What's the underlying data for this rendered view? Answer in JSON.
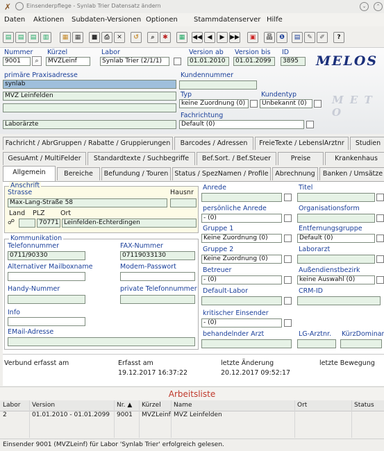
{
  "window": {
    "title": "Einsenderpflege - Synlab Trier Datensatz ändern"
  },
  "menu": [
    "Daten",
    "Aktionen",
    "Subdaten-Versionen",
    "Optionen",
    "Stammdatenserver",
    "Hilfe"
  ],
  "header": {
    "nummer_label": "Nummer",
    "nummer": "9001",
    "kuerzel_label": "Kürzel",
    "kuerzel": "MVZLeinf",
    "labor_label": "Labor",
    "labor": "Synlab Trier (2/1/1)",
    "version_ab_label": "Version ab",
    "version_ab": "01.01.2010",
    "version_bis_label": "Version bis",
    "version_bis": "01.01.2099",
    "id_label": "ID",
    "id": "3895",
    "logo": "MELOS",
    "praxis_label": "primäre Praxisadresse",
    "praxis1": "synlab",
    "praxis2": "MVZ Leinfelden",
    "praxis3": "",
    "praxis4": "Laborärzte",
    "kundennummer_label": "Kundennummer",
    "kundennummer": "",
    "typ_label": "Typ",
    "typ": "keine Zuordnung (0)",
    "kundentyp_label": "Kundentyp",
    "kundentyp": "Unbekannt (0)",
    "fachrichtung_label": "Fachrichtung",
    "fachrichtung": "Default (0)"
  },
  "tabs_row1": [
    "Fachricht / AbrGruppen / Rabatte / Gruppierungen",
    "Barcodes / Adressen",
    "FreieTexte / LebenslArztnr",
    "Studien"
  ],
  "tabs_row2": [
    "GesuAmt / MultiFelder",
    "Standardtexte / Suchbegriffe",
    "Bef.Sort. / Bef.Steuer",
    "Preise",
    "Krankenhaus"
  ],
  "tabs_row3": [
    "Allgemein",
    "Bereiche",
    "Befundung / Touren",
    "Status / SpezNamen / Profile",
    "Abrechnung",
    "Banken / Umsätze"
  ],
  "anschrift": {
    "group_label": "Anschrift",
    "strasse_label": "Strasse",
    "hausnr_label": "Hausnr",
    "strasse": "Max-Lang-Straße 58",
    "hausnr": "",
    "land_label": "Land",
    "plz_label": "PLZ",
    "ort_label": "Ort",
    "land": "",
    "plz": "70771",
    "ort": "Leinfelden-Echterdingen"
  },
  "kommunikation": {
    "group_label": "Kommunikation",
    "telefon_label": "Telefonnummer",
    "telefon": "0711/90330",
    "fax_label": "FAX-Nummer",
    "fax": "07119033130",
    "mailbox_label": "Alternativer Mailboxname",
    "mailbox": "",
    "modem_label": "Modem-Passwort",
    "modem": "",
    "handy_label": "Handy-Nummer",
    "handy": "",
    "privat_label": "private Telefonnummer",
    "privat": "",
    "info_label": "Info",
    "info": "",
    "email_label": "EMail-Adresse",
    "email": ""
  },
  "middle": {
    "anrede_label": "Anrede",
    "anrede": "",
    "pers_anrede_label": "persönliche Anrede",
    "pers_anrede": "- (0)",
    "gruppe1_label": "Gruppe 1",
    "gruppe1": "Keine Zuordnung (0)",
    "gruppe2_label": "Gruppe 2",
    "gruppe2": "Keine Zuordnung (0)",
    "betreuer_label": "Betreuer",
    "betreuer": "- (0)",
    "default_labor_label": "Default-Labor",
    "default_labor": "",
    "krit_label": "kritischer Einsender",
    "krit": "- (0)",
    "behandelnd_label": "behandelnder Arzt",
    "behandelnd": ""
  },
  "right": {
    "titel_label": "Titel",
    "titel": "",
    "org_label": "Organisationsform",
    "org": "",
    "entf_label": "Entfernungsgruppe",
    "entf": "Default (0)",
    "laborarzt_label": "Laborarzt",
    "laborarzt": "",
    "aussen_label": "Außendienstbezirk",
    "aussen": "keine Auswahl (0)",
    "crm_label": "CRM-ID",
    "crm": "",
    "lgarzt_label": "LG-Arztnr.",
    "lgarzt": "",
    "kurzdom_label": "KürzDominant",
    "kurzdom": ""
  },
  "footer_info": {
    "verbund_label": "Verbund erfasst am",
    "verbund": "",
    "erfasst_label": "Erfasst am",
    "erfasst": "19.12.2017 16:37:22",
    "aenderung_label": "letzte Änderung",
    "aenderung": "20.12.2017 09:52:17",
    "bewegung_label": "letzte Bewegung",
    "bewegung": ""
  },
  "arbeitsliste": {
    "title": "Arbeitsliste",
    "columns": [
      "Labor",
      "Version",
      "Nr. ▲",
      "Kürzel",
      "Name",
      "Ort",
      "Status"
    ],
    "rows": [
      [
        "2",
        "01.01.2010 - 01.01.2099",
        "9001",
        "MVZLeinf",
        "MVZ Leinfelden",
        "",
        ""
      ]
    ]
  },
  "status": "Einsender 9001 (MVZLeinf) für Labor 'Synlab Trier' erfolgreich gelesen.",
  "colors": {
    "accent": "#1a3f9a",
    "field": "#e6f2e6",
    "title_red": "#c0392b"
  }
}
